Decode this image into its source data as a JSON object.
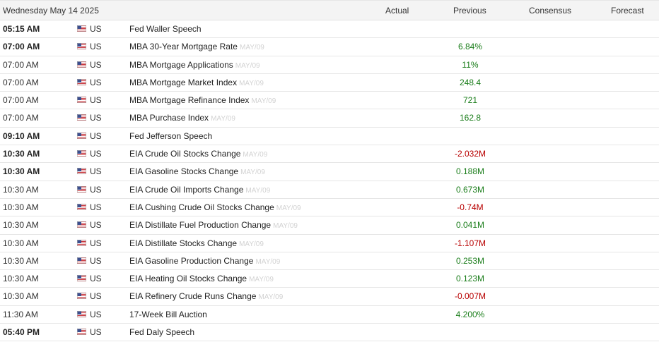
{
  "header": {
    "date": "Wednesday May 14 2025",
    "actual": "Actual",
    "previous": "Previous",
    "consensus": "Consensus",
    "forecast": "Forecast"
  },
  "colors": {
    "positive": "#1a7d1a",
    "negative": "#b80000",
    "period": "#d2d2d2",
    "header_bg": "#f4f4f4"
  },
  "rows": [
    {
      "time": "05:15 AM",
      "bold": true,
      "flag": "us-flag-icon",
      "country": "US",
      "event": "Fed Waller Speech",
      "period": "",
      "actual": "",
      "previous": "",
      "previous_sign": "",
      "consensus": "",
      "forecast": ""
    },
    {
      "time": "07:00 AM",
      "bold": true,
      "flag": "us-flag-icon",
      "country": "US",
      "event": "MBA 30-Year Mortgage Rate",
      "period": "MAY/09",
      "actual": "",
      "previous": "6.84%",
      "previous_sign": "pos",
      "consensus": "",
      "forecast": ""
    },
    {
      "time": "07:00 AM",
      "bold": false,
      "flag": "us-flag-icon",
      "country": "US",
      "event": "MBA Mortgage Applications",
      "period": "MAY/09",
      "actual": "",
      "previous": "11%",
      "previous_sign": "pos",
      "consensus": "",
      "forecast": ""
    },
    {
      "time": "07:00 AM",
      "bold": false,
      "flag": "us-flag-icon",
      "country": "US",
      "event": "MBA Mortgage Market Index",
      "period": "MAY/09",
      "actual": "",
      "previous": "248.4",
      "previous_sign": "pos",
      "consensus": "",
      "forecast": ""
    },
    {
      "time": "07:00 AM",
      "bold": false,
      "flag": "us-flag-icon",
      "country": "US",
      "event": "MBA Mortgage Refinance Index",
      "period": "MAY/09",
      "actual": "",
      "previous": "721",
      "previous_sign": "pos",
      "consensus": "",
      "forecast": ""
    },
    {
      "time": "07:00 AM",
      "bold": false,
      "flag": "us-flag-icon",
      "country": "US",
      "event": "MBA Purchase Index",
      "period": "MAY/09",
      "actual": "",
      "previous": "162.8",
      "previous_sign": "pos",
      "consensus": "",
      "forecast": ""
    },
    {
      "time": "09:10 AM",
      "bold": true,
      "flag": "us-flag-icon",
      "country": "US",
      "event": "Fed Jefferson Speech",
      "period": "",
      "actual": "",
      "previous": "",
      "previous_sign": "",
      "consensus": "",
      "forecast": ""
    },
    {
      "time": "10:30 AM",
      "bold": true,
      "flag": "us-flag-icon",
      "country": "US",
      "event": "EIA Crude Oil Stocks Change",
      "period": "MAY/09",
      "actual": "",
      "previous": "-2.032M",
      "previous_sign": "neg",
      "consensus": "",
      "forecast": ""
    },
    {
      "time": "10:30 AM",
      "bold": true,
      "flag": "us-flag-icon",
      "country": "US",
      "event": "EIA Gasoline Stocks Change",
      "period": "MAY/09",
      "actual": "",
      "previous": "0.188M",
      "previous_sign": "pos",
      "consensus": "",
      "forecast": ""
    },
    {
      "time": "10:30 AM",
      "bold": false,
      "flag": "us-flag-icon",
      "country": "US",
      "event": "EIA Crude Oil Imports Change",
      "period": "MAY/09",
      "actual": "",
      "previous": "0.673M",
      "previous_sign": "pos",
      "consensus": "",
      "forecast": ""
    },
    {
      "time": "10:30 AM",
      "bold": false,
      "flag": "us-flag-icon",
      "country": "US",
      "event": "EIA Cushing Crude Oil Stocks Change",
      "period": "MAY/09",
      "actual": "",
      "previous": "-0.74M",
      "previous_sign": "neg",
      "consensus": "",
      "forecast": ""
    },
    {
      "time": "10:30 AM",
      "bold": false,
      "flag": "us-flag-icon",
      "country": "US",
      "event": "EIA Distillate Fuel Production Change",
      "period": "MAY/09",
      "actual": "",
      "previous": "0.041M",
      "previous_sign": "pos",
      "consensus": "",
      "forecast": ""
    },
    {
      "time": "10:30 AM",
      "bold": false,
      "flag": "us-flag-icon",
      "country": "US",
      "event": "EIA Distillate Stocks Change",
      "period": "MAY/09",
      "actual": "",
      "previous": "-1.107M",
      "previous_sign": "neg",
      "consensus": "",
      "forecast": ""
    },
    {
      "time": "10:30 AM",
      "bold": false,
      "flag": "us-flag-icon",
      "country": "US",
      "event": "EIA Gasoline Production Change",
      "period": "MAY/09",
      "actual": "",
      "previous": "0.253M",
      "previous_sign": "pos",
      "consensus": "",
      "forecast": ""
    },
    {
      "time": "10:30 AM",
      "bold": false,
      "flag": "us-flag-icon",
      "country": "US",
      "event": "EIA Heating Oil Stocks Change",
      "period": "MAY/09",
      "actual": "",
      "previous": "0.123M",
      "previous_sign": "pos",
      "consensus": "",
      "forecast": ""
    },
    {
      "time": "10:30 AM",
      "bold": false,
      "flag": "us-flag-icon",
      "country": "US",
      "event": "EIA Refinery Crude Runs Change",
      "period": "MAY/09",
      "actual": "",
      "previous": "-0.007M",
      "previous_sign": "neg",
      "consensus": "",
      "forecast": ""
    },
    {
      "time": "11:30 AM",
      "bold": false,
      "flag": "us-flag-icon",
      "country": "US",
      "event": "17-Week Bill Auction",
      "period": "",
      "actual": "",
      "previous": "4.200%",
      "previous_sign": "pos",
      "consensus": "",
      "forecast": ""
    },
    {
      "time": "05:40 PM",
      "bold": true,
      "flag": "us-flag-icon",
      "country": "US",
      "event": "Fed Daly Speech",
      "period": "",
      "actual": "",
      "previous": "",
      "previous_sign": "",
      "consensus": "",
      "forecast": ""
    }
  ]
}
